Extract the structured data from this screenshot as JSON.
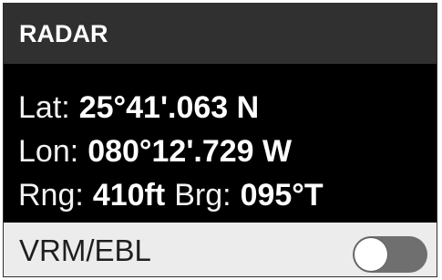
{
  "panel": {
    "title": "RADAR",
    "readouts": {
      "lat_label": "Lat:",
      "lat_value": "25°41'.063 N",
      "lon_label": "Lon:",
      "lon_value": "080°12'.729 W",
      "rng_label": "Rng:",
      "rng_value": "410ft",
      "brg_label": "Brg:",
      "brg_value": "095°T"
    },
    "vrm_ebl": {
      "label": "VRM/EBL",
      "toggle_state": "off"
    }
  },
  "colors": {
    "header_bg": "#303030",
    "body_bg": "#000000",
    "footer_bg": "#ececec",
    "toggle_track": "#6f6f6f",
    "toggle_knob": "#ffffff"
  },
  "icons": {
    "toggle": "toggle-switch-off"
  }
}
